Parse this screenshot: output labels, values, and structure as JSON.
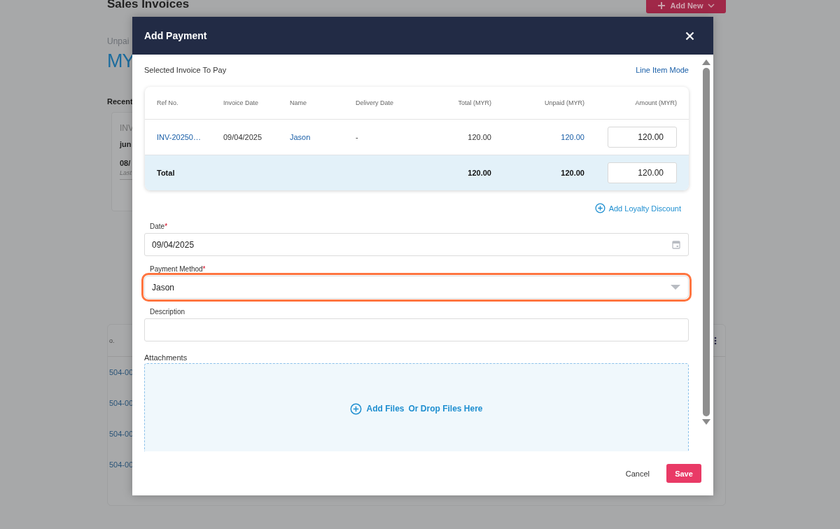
{
  "background_page": {
    "title": "Sales Invoices",
    "add_button": "Add New",
    "summary_label": "Unpai",
    "summary_value": "MY",
    "recent_heading": "Recent",
    "recent_card": {
      "ref": "INV",
      "name": "jun",
      "date": "08/",
      "note": "Last"
    },
    "table": {
      "column_1": "o.",
      "rows": [
        "504-00",
        "504-00",
        "504-00",
        "504-00"
      ]
    }
  },
  "dialog": {
    "title": "Add Payment",
    "section_label": "Selected Invoice To Pay",
    "mode_link": "Line Item Mode",
    "invoice_table": {
      "columns": [
        "Ref No.",
        "Invoice Date",
        "Name",
        "Delivery Date",
        "Total (MYR)",
        "Unpaid (MYR)",
        "Amount (MYR)"
      ],
      "rows": [
        {
          "ref_no": "INV-20250…",
          "invoice_date": "09/04/2025",
          "name": "Jason",
          "delivery_date": "-",
          "total": "120.00",
          "unpaid": "120.00",
          "amount": "120.00"
        }
      ],
      "total_row": {
        "label": "Total",
        "total": "120.00",
        "unpaid": "120.00",
        "amount": "120.00"
      }
    },
    "loyalty_link": "Add Loyalty Discount",
    "fields": [
      {
        "kind": "date",
        "label": "Date",
        "required_mark": "*",
        "value": "09/04/2025",
        "highlighted": false
      },
      {
        "kind": "select",
        "label": "Payment Method",
        "required_mark": "*",
        "value": "Jason",
        "highlighted": true
      },
      {
        "kind": "text",
        "label": "Description",
        "highlighted": false
      }
    ],
    "attachments": {
      "label": "Attachments",
      "add_link": "Add Files",
      "drop_hint": "Or Drop Files Here"
    },
    "buttons": {
      "cancel": "Cancel",
      "save": "Save"
    }
  }
}
